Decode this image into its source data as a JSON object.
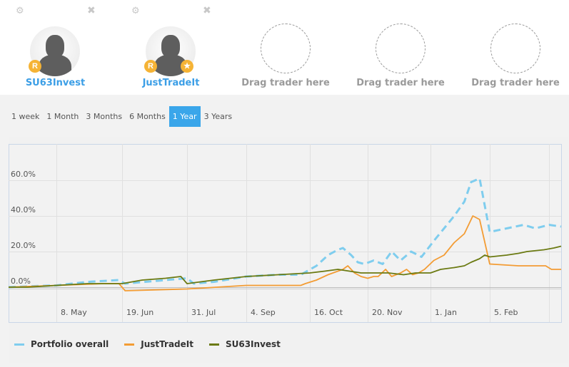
{
  "traders": [
    {
      "name": "SU63Invest",
      "badges": [
        "R"
      ],
      "gear_icon": "gear-icon",
      "close_icon": "close-icon"
    },
    {
      "name": "JustTradeIt",
      "badges": [
        "R",
        "star"
      ],
      "gear_icon": "gear-icon",
      "close_icon": "close-icon"
    }
  ],
  "empty_slots": [
    {
      "label": "Drag trader here"
    },
    {
      "label": "Drag trader here"
    },
    {
      "label": "Drag trader here"
    }
  ],
  "badge_labels": {
    "r": "R",
    "star": "★"
  },
  "icons": {
    "gear": "⚙",
    "close": "✖"
  },
  "time_ranges": [
    {
      "label": "1 week",
      "active": false
    },
    {
      "label": "1 Month",
      "active": false
    },
    {
      "label": "3 Months",
      "active": false
    },
    {
      "label": "6 Months",
      "active": false
    },
    {
      "label": "1 Year",
      "active": true
    },
    {
      "label": "3 Years",
      "active": false
    }
  ],
  "colors": {
    "accent": "#3aa6ea",
    "trader_name": "#3b9ee6",
    "badge": "#f5b335",
    "portfolio": "#7fcdee",
    "justtradeit": "#f39c34",
    "su63invest": "#6b7a12"
  },
  "chart_data": {
    "type": "line",
    "title": "",
    "xlabel": "",
    "ylabel": "",
    "x_unit": "days since 8. May",
    "xlim": [
      -30,
      318
    ],
    "ylim": [
      -20,
      80
    ],
    "grid": true,
    "legend_position": "bottom-left",
    "x_ticks": [
      {
        "label": "8. May",
        "day": 0
      },
      {
        "label": "19. Jun",
        "day": 42
      },
      {
        "label": "31. Jul",
        "day": 84
      },
      {
        "label": "4. Sep",
        "day": 119
      },
      {
        "label": "16. Oct",
        "day": 161
      },
      {
        "label": "20. Nov",
        "day": 196
      },
      {
        "label": "1. Jan",
        "day": 238
      },
      {
        "label": "5. Feb",
        "day": 273
      },
      {
        "label": "",
        "day": 308
      }
    ],
    "y_ticks": [
      {
        "label": "0.0%",
        "value": 0
      },
      {
        "label": "20.0%",
        "value": 20
      },
      {
        "label": "40.0%",
        "value": 40
      },
      {
        "label": "60.0%",
        "value": 60
      }
    ],
    "series": [
      {
        "name": "Portfolio overall",
        "style": "dashed",
        "points": [
          [
            -30,
            0
          ],
          [
            -18,
            0.5
          ],
          [
            0,
            1
          ],
          [
            20,
            3
          ],
          [
            40,
            4
          ],
          [
            44,
            2
          ],
          [
            70,
            4
          ],
          [
            84,
            5
          ],
          [
            88,
            2
          ],
          [
            100,
            3
          ],
          [
            119,
            6
          ],
          [
            140,
            7
          ],
          [
            155,
            7
          ],
          [
            165,
            12
          ],
          [
            172,
            18
          ],
          [
            178,
            21
          ],
          [
            181,
            22
          ],
          [
            186,
            18
          ],
          [
            190,
            14
          ],
          [
            194,
            13
          ],
          [
            200,
            15
          ],
          [
            206,
            13
          ],
          [
            212,
            20
          ],
          [
            218,
            15
          ],
          [
            225,
            20
          ],
          [
            232,
            17
          ],
          [
            240,
            26
          ],
          [
            246,
            33
          ],
          [
            252,
            40
          ],
          [
            258,
            48
          ],
          [
            262,
            59
          ],
          [
            267,
            61
          ],
          [
            273,
            31
          ],
          [
            283,
            33
          ],
          [
            293,
            35
          ],
          [
            300,
            33
          ],
          [
            308,
            35
          ],
          [
            318,
            34
          ]
        ]
      },
      {
        "name": "JustTradeIt",
        "style": "solid",
        "points": [
          [
            -30,
            0
          ],
          [
            0,
            1
          ],
          [
            30,
            2
          ],
          [
            40,
            2
          ],
          [
            44,
            -2
          ],
          [
            84,
            -1
          ],
          [
            119,
            1
          ],
          [
            155,
            1
          ],
          [
            158,
            2
          ],
          [
            165,
            4
          ],
          [
            172,
            7
          ],
          [
            178,
            9
          ],
          [
            181,
            10
          ],
          [
            184,
            12
          ],
          [
            188,
            8
          ],
          [
            192,
            6
          ],
          [
            196,
            5
          ],
          [
            200,
            6
          ],
          [
            203,
            6
          ],
          [
            208,
            10
          ],
          [
            212,
            6
          ],
          [
            218,
            8
          ],
          [
            222,
            10
          ],
          [
            226,
            7
          ],
          [
            230,
            8
          ],
          [
            234,
            10
          ],
          [
            240,
            15
          ],
          [
            246,
            18
          ],
          [
            252,
            25
          ],
          [
            258,
            30
          ],
          [
            263,
            40
          ],
          [
            267,
            38
          ],
          [
            273,
            13
          ],
          [
            290,
            12
          ],
          [
            306,
            12
          ],
          [
            310,
            10
          ],
          [
            318,
            10
          ]
        ]
      },
      {
        "name": "SU63Invest",
        "style": "solid",
        "points": [
          [
            -30,
            0
          ],
          [
            -18,
            0
          ],
          [
            0,
            1
          ],
          [
            20,
            2
          ],
          [
            42,
            2
          ],
          [
            55,
            4
          ],
          [
            70,
            5
          ],
          [
            80,
            6
          ],
          [
            84,
            2
          ],
          [
            100,
            4
          ],
          [
            119,
            6
          ],
          [
            140,
            7
          ],
          [
            161,
            8
          ],
          [
            170,
            9
          ],
          [
            178,
            10
          ],
          [
            185,
            9
          ],
          [
            192,
            8
          ],
          [
            200,
            8
          ],
          [
            210,
            8
          ],
          [
            220,
            7
          ],
          [
            228,
            8
          ],
          [
            238,
            8
          ],
          [
            244,
            10
          ],
          [
            252,
            11
          ],
          [
            258,
            12
          ],
          [
            262,
            14
          ],
          [
            267,
            16
          ],
          [
            270,
            18
          ],
          [
            273,
            17
          ],
          [
            283,
            18
          ],
          [
            290,
            19
          ],
          [
            295,
            20
          ],
          [
            305,
            21
          ],
          [
            312,
            22
          ],
          [
            318,
            23
          ]
        ]
      }
    ]
  }
}
